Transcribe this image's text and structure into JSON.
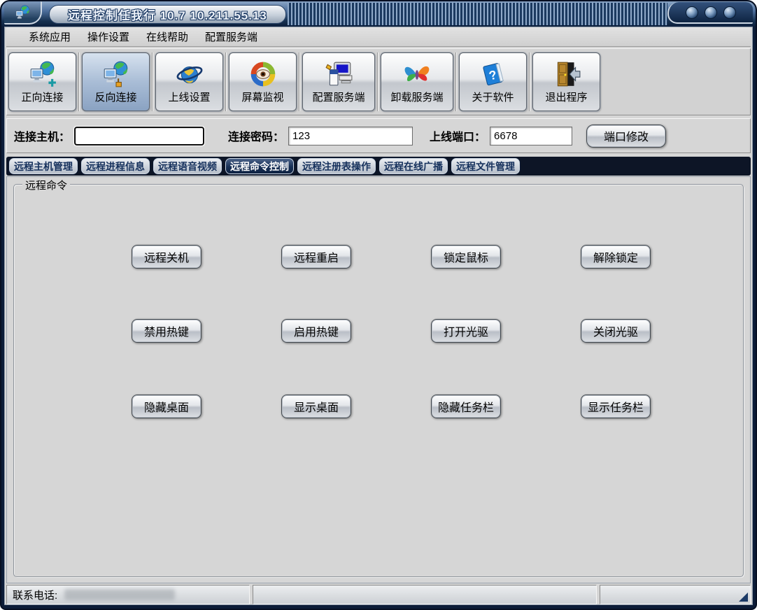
{
  "colors": {
    "title_bar_navy": "#16304f",
    "active_tab_navy": "#162f56",
    "panel_gray": "#d6d6d6",
    "pressed_button_blue": "#a9bdd6"
  },
  "window": {
    "title": "远程控制任我行 10.7  10.211.55.13",
    "app_icon": "remote-app-icon",
    "control_buttons": [
      "window-orb-1",
      "window-orb-2",
      "window-orb-3"
    ]
  },
  "menu": {
    "items": [
      "系统应用",
      "操作设置",
      "在线帮助",
      "配置服务端"
    ]
  },
  "toolbar": {
    "buttons": [
      {
        "label": "正向连接",
        "icon": "forward-connect-icon",
        "pressed": false
      },
      {
        "label": "反向连接",
        "icon": "reverse-connect-icon",
        "pressed": true
      },
      {
        "label": "上线设置",
        "icon": "online-settings-icon",
        "pressed": false
      },
      {
        "label": "屏幕监视",
        "icon": "screen-monitor-icon",
        "pressed": false
      },
      {
        "label": "配置服务端",
        "icon": "configure-server-icon",
        "pressed": false
      },
      {
        "label": "卸载服务端",
        "icon": "uninstall-server-icon",
        "pressed": false
      },
      {
        "label": "关于软件",
        "icon": "about-software-icon",
        "pressed": false
      },
      {
        "label": "退出程序",
        "icon": "exit-program-icon",
        "pressed": false
      }
    ]
  },
  "connection": {
    "host_label": "连接主机：",
    "host_value": "",
    "password_label": "连接密码：",
    "password_value": "123",
    "port_label": "上线端口：",
    "port_value": "6678",
    "port_modify_button": "端口修改"
  },
  "tabs": [
    {
      "label": "远程主机管理",
      "active": false
    },
    {
      "label": "远程进程信息",
      "active": false
    },
    {
      "label": "远程语音视频",
      "active": false
    },
    {
      "label": "远程命令控制",
      "active": true
    },
    {
      "label": "远程注册表操作",
      "active": false
    },
    {
      "label": "远程在线广播",
      "active": false
    },
    {
      "label": "远程文件管理",
      "active": false
    }
  ],
  "command_panel": {
    "group_title": "远程命令",
    "rows": [
      [
        "远程关机",
        "远程重启",
        "锁定鼠标",
        "解除锁定"
      ],
      [
        "禁用热键",
        "启用热键",
        "打开光驱",
        "关闭光驱"
      ],
      [
        "隐藏桌面",
        "显示桌面",
        "隐藏任务栏",
        "显示任务栏"
      ]
    ]
  },
  "statusbar": {
    "contact_label": "联系电话:",
    "contact_value_redacted": true
  }
}
